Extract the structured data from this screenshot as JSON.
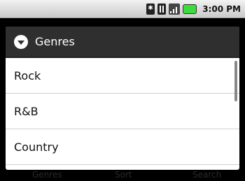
{
  "status_bar": {
    "time": "3:00 PM",
    "icons": [
      "bluetooth-icon",
      "data-icon",
      "signal-icon",
      "battery-icon"
    ]
  },
  "background_tabs": [
    "Genres",
    "Sort",
    "Search"
  ],
  "dialog": {
    "title": "Genres",
    "title_icon": "dropdown-circle-icon",
    "items": [
      {
        "label": "Rock"
      },
      {
        "label": "R&B"
      },
      {
        "label": "Country"
      }
    ]
  }
}
